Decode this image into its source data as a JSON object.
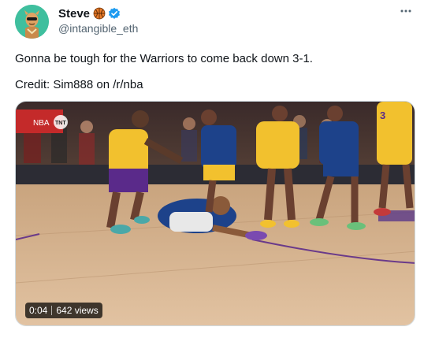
{
  "author": {
    "name": "Steve",
    "handle": "@intangible_eth",
    "badges": [
      "basketball-icon",
      "verified-icon"
    ]
  },
  "tweet": {
    "text": "Gonna be tough for the Warriors to come back down 3-1.",
    "credit": "Credit: Sim888 on /r/nba"
  },
  "video": {
    "duration": "0:04",
    "views": "642 views",
    "overlay_text": {
      "jersey_number": "3",
      "network_logo": "TNT",
      "banner": "NBA"
    }
  },
  "colors": {
    "avatar_bg": "#3fbf9e",
    "verified": "#1d9bf0",
    "handle_gray": "#536471",
    "lakers_gold": "#f2c12e",
    "warriors_blue": "#1d428a",
    "court_wood": "#d9b48f"
  }
}
